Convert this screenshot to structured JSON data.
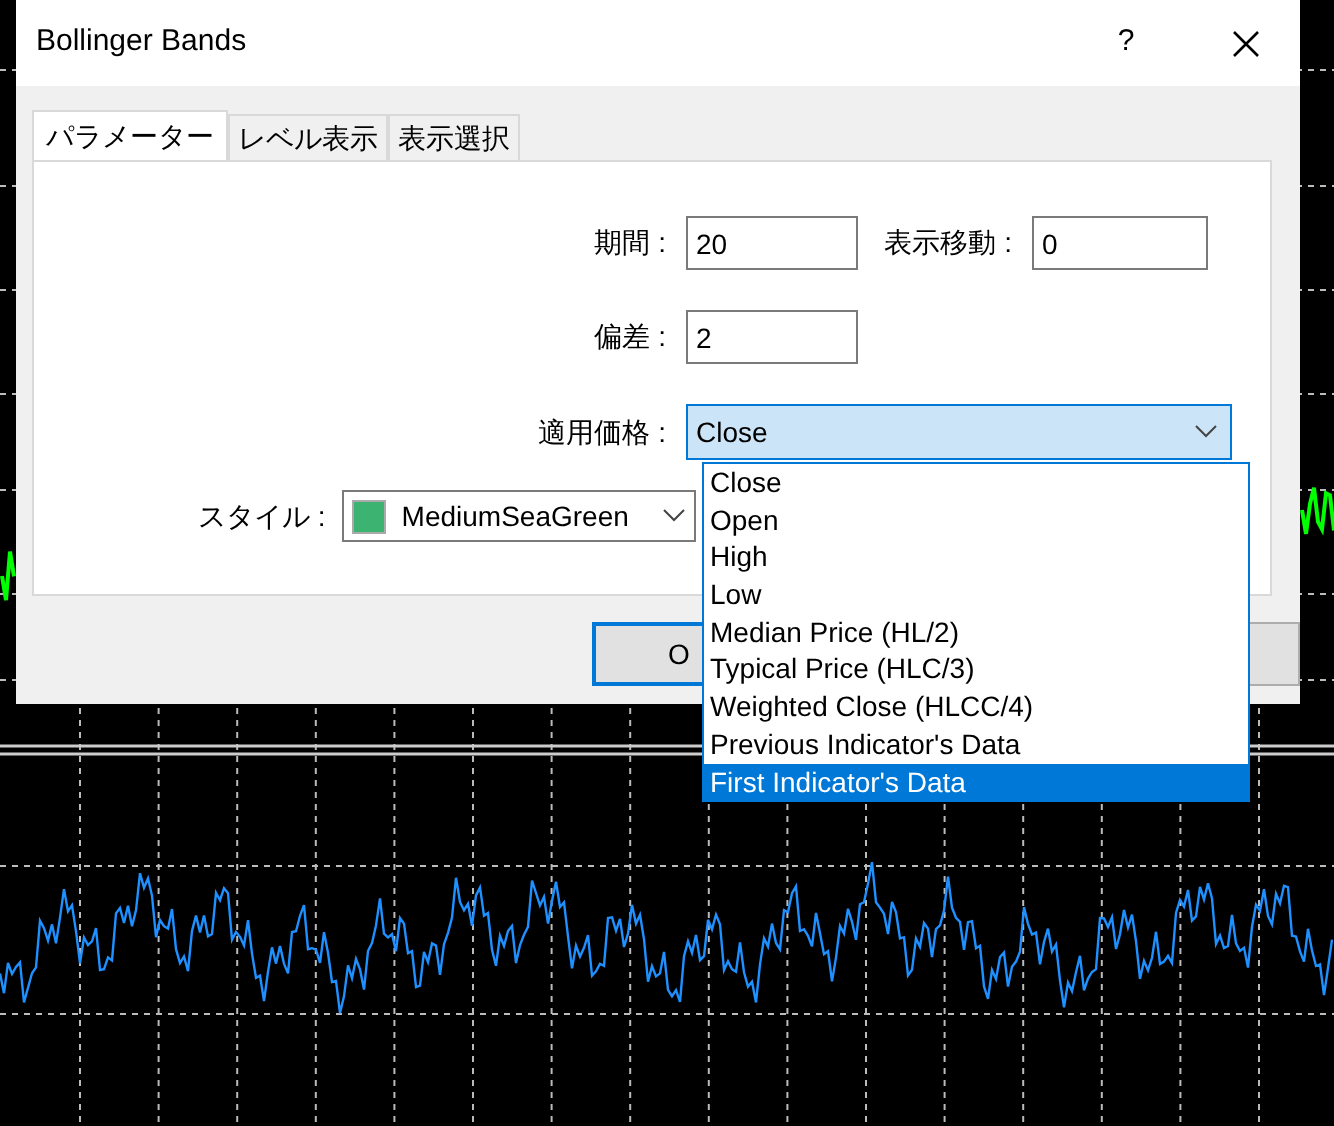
{
  "window": {
    "title": "Bollinger Bands",
    "help": "?"
  },
  "tabs": [
    {
      "label": "パラメーター",
      "selected": true
    },
    {
      "label": "レベル表示",
      "selected": false
    },
    {
      "label": "表示選択",
      "selected": false
    }
  ],
  "period": {
    "label": "期間 :",
    "value": "20"
  },
  "shift": {
    "label": "表示移動 :",
    "value": "0"
  },
  "deviation": {
    "label": "偏差 :",
    "value": "2"
  },
  "applied_price": {
    "label": "適用価格 :",
    "value": "Close",
    "expanded": true,
    "options": [
      {
        "label": "Close",
        "highlighted": false
      },
      {
        "label": "Open",
        "highlighted": false
      },
      {
        "label": "High",
        "highlighted": false
      },
      {
        "label": "Low",
        "highlighted": false
      },
      {
        "label": "Median Price (HL/2)",
        "highlighted": false
      },
      {
        "label": "Typical Price (HLC/3)",
        "highlighted": false
      },
      {
        "label": "Weighted Close (HLCC/4)",
        "highlighted": false
      },
      {
        "label": "Previous Indicator's Data",
        "highlighted": false
      },
      {
        "label": "First Indicator's Data",
        "highlighted": true
      }
    ]
  },
  "style": {
    "label": "スタイル :",
    "value": "MediumSeaGreen",
    "color": "#3cb371"
  },
  "ok_button": {
    "label": "O"
  }
}
